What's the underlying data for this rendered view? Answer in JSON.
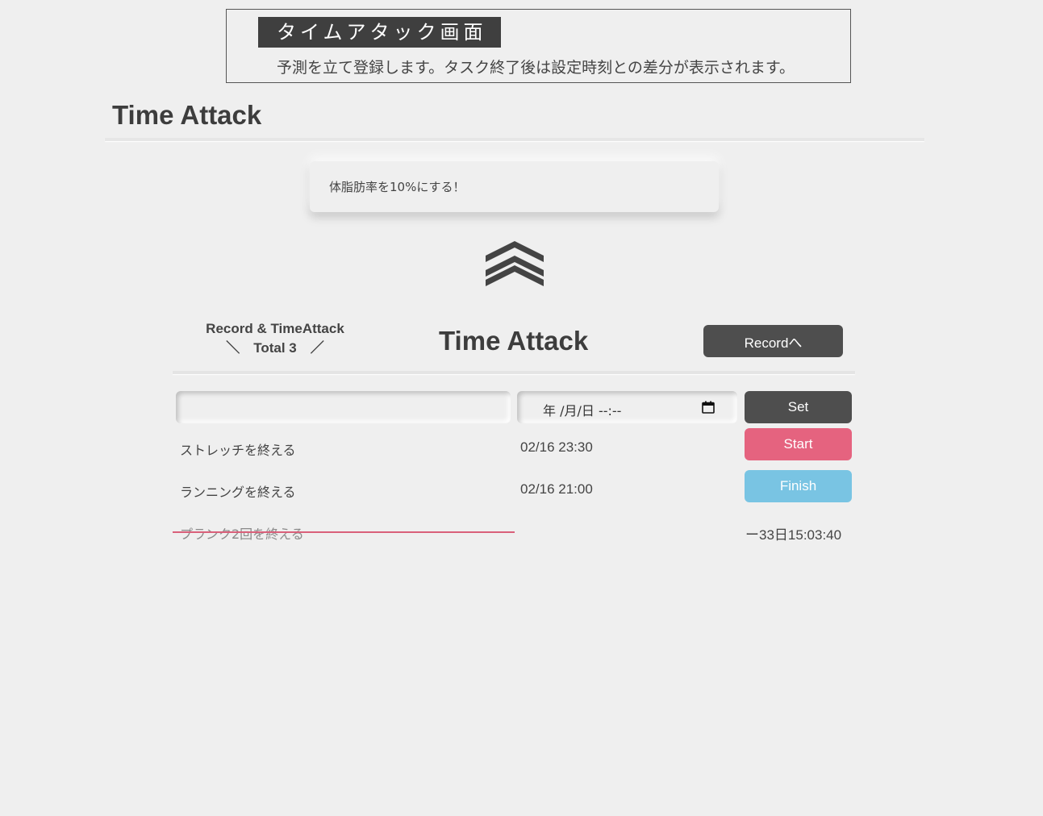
{
  "banner": {
    "title": "タイムアタック画面",
    "description": "予測を立て登録します。タスク終了後は設定時刻との差分が表示されます。"
  },
  "page_title": "Time Attack",
  "goal": {
    "text": "体脂肪率を10%にする！"
  },
  "icons": {
    "goal_up": "triple-chevron-up-icon",
    "calendar": "calendar-icon"
  },
  "section": {
    "record_label_line1": "Record & TimeAttack",
    "record_label_line2": "＼　Total 3　／",
    "title": "Time Attack",
    "record_button": "Recordへ"
  },
  "form": {
    "task_value": "",
    "date_placeholder": "年 /月/日 --:--",
    "set_button": "Set"
  },
  "tasks": [
    {
      "name": "ストレッチを終える",
      "time": "02/16 23:30",
      "action": "Start",
      "action_color": "#e5637f"
    },
    {
      "name": "ランニングを終える",
      "time": "02/16 21:00",
      "action": "Finish",
      "action_color": "#79c4e3"
    },
    {
      "name": "プランク2回を終える",
      "completed": true,
      "diff": "ー33日15:03:40"
    }
  ],
  "colors": {
    "dark": "#4e4e4e",
    "start": "#e5637f",
    "finish": "#79c4e3",
    "strike": "#d9607a"
  }
}
